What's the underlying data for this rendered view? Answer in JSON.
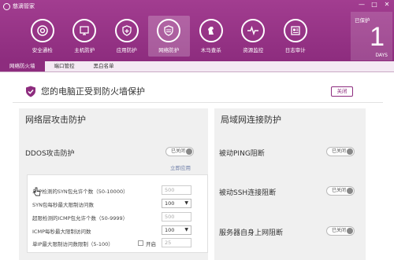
{
  "app": {
    "title": "慈滴管家"
  },
  "window_controls": {
    "minimize": "—",
    "maximize": "□",
    "close": "✕"
  },
  "nav": [
    {
      "label": "安全通检",
      "icon": "scan-icon"
    },
    {
      "label": "主机防护",
      "icon": "host-protect-icon"
    },
    {
      "label": "应用防护",
      "icon": "app-protect-icon"
    },
    {
      "label": "网络防护",
      "icon": "network-protect-icon",
      "active": true
    },
    {
      "label": "木马查杀",
      "icon": "trojan-kill-icon"
    },
    {
      "label": "资源监控",
      "icon": "resource-monitor-icon"
    },
    {
      "label": "日志审计",
      "icon": "log-audit-icon"
    }
  ],
  "days": {
    "prefix": "已保护",
    "count": "1",
    "unit": "DAYS"
  },
  "tabs": [
    {
      "label": "网络防火墙",
      "active": true
    },
    {
      "label": "端口管控"
    },
    {
      "label": "黑白名单"
    }
  ],
  "status": {
    "text": "您的电脑正受到防火墙保护",
    "close_label": "关闭"
  },
  "left_panel": {
    "title": "网络层攻击防护",
    "ddos_label": "DDOS攻击防护",
    "ddos_toggle": "已关闭",
    "apply_link": "立即应用",
    "fields": [
      {
        "label": "单IP检测的SYN包允许个数（50-10000）",
        "value": "500",
        "type": "input"
      },
      {
        "label": "SYN包每秒最大限制访问数",
        "value": "100",
        "type": "select"
      },
      {
        "label": "超限检测的ICMP包允许个数（50-9999）",
        "value": "500",
        "type": "input"
      },
      {
        "label": "ICMP每秒最大限制访问数",
        "value": "100",
        "type": "select"
      },
      {
        "label": "单IP最大限制访问数限制（5-100）",
        "value": "25",
        "type": "input",
        "check_label": "开启"
      }
    ]
  },
  "right_panel": {
    "title": "局域网连接防护",
    "items": [
      {
        "label": "被动PING阻断",
        "toggle": "已关闭"
      },
      {
        "label": "被动SSH连接阻断",
        "toggle": "已关闭"
      },
      {
        "label": "服务器自身上网阻断",
        "toggle": "已关闭"
      }
    ]
  },
  "colors": {
    "brand": "#8d2c7e",
    "brand_light": "#a23d90",
    "panel": "#f0f0f0"
  }
}
